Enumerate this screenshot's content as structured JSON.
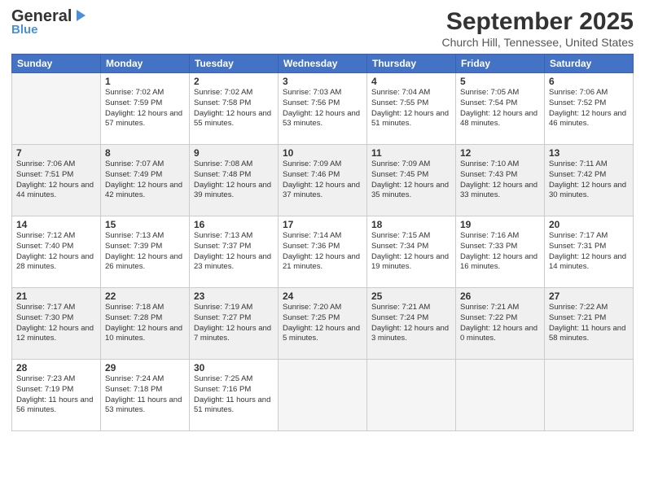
{
  "logo": {
    "general": "General",
    "blue": "Blue",
    "icon": "▶"
  },
  "header": {
    "month": "September 2025",
    "location": "Church Hill, Tennessee, United States"
  },
  "weekdays": [
    "Sunday",
    "Monday",
    "Tuesday",
    "Wednesday",
    "Thursday",
    "Friday",
    "Saturday"
  ],
  "weeks": [
    [
      {
        "day": "",
        "sunrise": "",
        "sunset": "",
        "daylight": "",
        "empty": true
      },
      {
        "day": "1",
        "sunrise": "Sunrise: 7:02 AM",
        "sunset": "Sunset: 7:59 PM",
        "daylight": "Daylight: 12 hours and 57 minutes."
      },
      {
        "day": "2",
        "sunrise": "Sunrise: 7:02 AM",
        "sunset": "Sunset: 7:58 PM",
        "daylight": "Daylight: 12 hours and 55 minutes."
      },
      {
        "day": "3",
        "sunrise": "Sunrise: 7:03 AM",
        "sunset": "Sunset: 7:56 PM",
        "daylight": "Daylight: 12 hours and 53 minutes."
      },
      {
        "day": "4",
        "sunrise": "Sunrise: 7:04 AM",
        "sunset": "Sunset: 7:55 PM",
        "daylight": "Daylight: 12 hours and 51 minutes."
      },
      {
        "day": "5",
        "sunrise": "Sunrise: 7:05 AM",
        "sunset": "Sunset: 7:54 PM",
        "daylight": "Daylight: 12 hours and 48 minutes."
      },
      {
        "day": "6",
        "sunrise": "Sunrise: 7:06 AM",
        "sunset": "Sunset: 7:52 PM",
        "daylight": "Daylight: 12 hours and 46 minutes."
      }
    ],
    [
      {
        "day": "7",
        "sunrise": "Sunrise: 7:06 AM",
        "sunset": "Sunset: 7:51 PM",
        "daylight": "Daylight: 12 hours and 44 minutes."
      },
      {
        "day": "8",
        "sunrise": "Sunrise: 7:07 AM",
        "sunset": "Sunset: 7:49 PM",
        "daylight": "Daylight: 12 hours and 42 minutes."
      },
      {
        "day": "9",
        "sunrise": "Sunrise: 7:08 AM",
        "sunset": "Sunset: 7:48 PM",
        "daylight": "Daylight: 12 hours and 39 minutes."
      },
      {
        "day": "10",
        "sunrise": "Sunrise: 7:09 AM",
        "sunset": "Sunset: 7:46 PM",
        "daylight": "Daylight: 12 hours and 37 minutes."
      },
      {
        "day": "11",
        "sunrise": "Sunrise: 7:09 AM",
        "sunset": "Sunset: 7:45 PM",
        "daylight": "Daylight: 12 hours and 35 minutes."
      },
      {
        "day": "12",
        "sunrise": "Sunrise: 7:10 AM",
        "sunset": "Sunset: 7:43 PM",
        "daylight": "Daylight: 12 hours and 33 minutes."
      },
      {
        "day": "13",
        "sunrise": "Sunrise: 7:11 AM",
        "sunset": "Sunset: 7:42 PM",
        "daylight": "Daylight: 12 hours and 30 minutes."
      }
    ],
    [
      {
        "day": "14",
        "sunrise": "Sunrise: 7:12 AM",
        "sunset": "Sunset: 7:40 PM",
        "daylight": "Daylight: 12 hours and 28 minutes."
      },
      {
        "day": "15",
        "sunrise": "Sunrise: 7:13 AM",
        "sunset": "Sunset: 7:39 PM",
        "daylight": "Daylight: 12 hours and 26 minutes."
      },
      {
        "day": "16",
        "sunrise": "Sunrise: 7:13 AM",
        "sunset": "Sunset: 7:37 PM",
        "daylight": "Daylight: 12 hours and 23 minutes."
      },
      {
        "day": "17",
        "sunrise": "Sunrise: 7:14 AM",
        "sunset": "Sunset: 7:36 PM",
        "daylight": "Daylight: 12 hours and 21 minutes."
      },
      {
        "day": "18",
        "sunrise": "Sunrise: 7:15 AM",
        "sunset": "Sunset: 7:34 PM",
        "daylight": "Daylight: 12 hours and 19 minutes."
      },
      {
        "day": "19",
        "sunrise": "Sunrise: 7:16 AM",
        "sunset": "Sunset: 7:33 PM",
        "daylight": "Daylight: 12 hours and 16 minutes."
      },
      {
        "day": "20",
        "sunrise": "Sunrise: 7:17 AM",
        "sunset": "Sunset: 7:31 PM",
        "daylight": "Daylight: 12 hours and 14 minutes."
      }
    ],
    [
      {
        "day": "21",
        "sunrise": "Sunrise: 7:17 AM",
        "sunset": "Sunset: 7:30 PM",
        "daylight": "Daylight: 12 hours and 12 minutes."
      },
      {
        "day": "22",
        "sunrise": "Sunrise: 7:18 AM",
        "sunset": "Sunset: 7:28 PM",
        "daylight": "Daylight: 12 hours and 10 minutes."
      },
      {
        "day": "23",
        "sunrise": "Sunrise: 7:19 AM",
        "sunset": "Sunset: 7:27 PM",
        "daylight": "Daylight: 12 hours and 7 minutes."
      },
      {
        "day": "24",
        "sunrise": "Sunrise: 7:20 AM",
        "sunset": "Sunset: 7:25 PM",
        "daylight": "Daylight: 12 hours and 5 minutes."
      },
      {
        "day": "25",
        "sunrise": "Sunrise: 7:21 AM",
        "sunset": "Sunset: 7:24 PM",
        "daylight": "Daylight: 12 hours and 3 minutes."
      },
      {
        "day": "26",
        "sunrise": "Sunrise: 7:21 AM",
        "sunset": "Sunset: 7:22 PM",
        "daylight": "Daylight: 12 hours and 0 minutes."
      },
      {
        "day": "27",
        "sunrise": "Sunrise: 7:22 AM",
        "sunset": "Sunset: 7:21 PM",
        "daylight": "Daylight: 11 hours and 58 minutes."
      }
    ],
    [
      {
        "day": "28",
        "sunrise": "Sunrise: 7:23 AM",
        "sunset": "Sunset: 7:19 PM",
        "daylight": "Daylight: 11 hours and 56 minutes."
      },
      {
        "day": "29",
        "sunrise": "Sunrise: 7:24 AM",
        "sunset": "Sunset: 7:18 PM",
        "daylight": "Daylight: 11 hours and 53 minutes."
      },
      {
        "day": "30",
        "sunrise": "Sunrise: 7:25 AM",
        "sunset": "Sunset: 7:16 PM",
        "daylight": "Daylight: 11 hours and 51 minutes."
      },
      {
        "day": "",
        "sunrise": "",
        "sunset": "",
        "daylight": "",
        "empty": true
      },
      {
        "day": "",
        "sunrise": "",
        "sunset": "",
        "daylight": "",
        "empty": true
      },
      {
        "day": "",
        "sunrise": "",
        "sunset": "",
        "daylight": "",
        "empty": true
      },
      {
        "day": "",
        "sunrise": "",
        "sunset": "",
        "daylight": "",
        "empty": true
      }
    ]
  ]
}
